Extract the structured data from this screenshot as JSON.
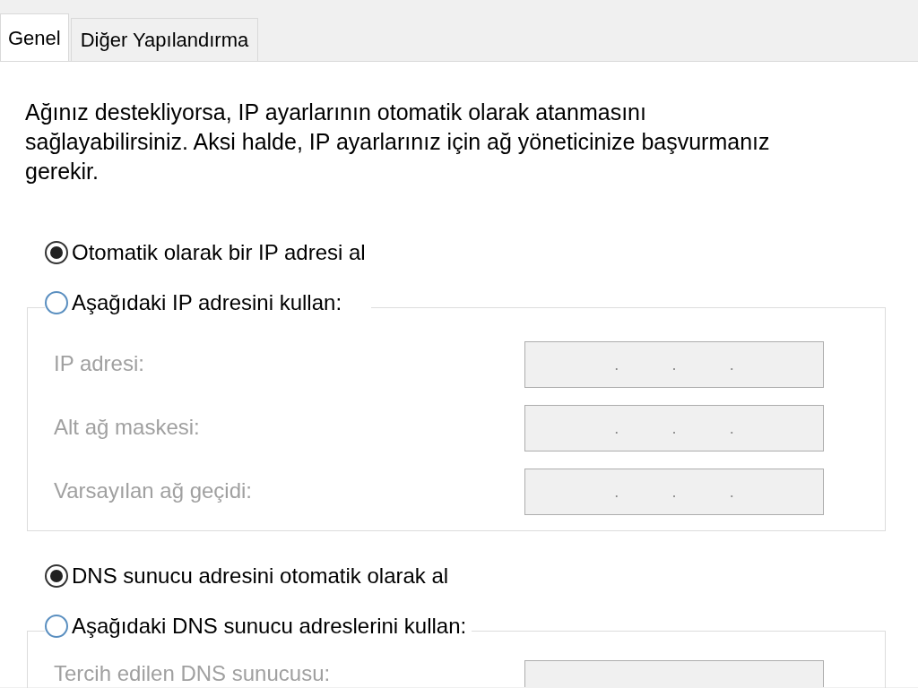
{
  "tabs": [
    {
      "label": "Genel",
      "selected": true
    },
    {
      "label": "Diğer Yapılandırma",
      "selected": false
    }
  ],
  "description": "Ağınız destekliyorsa, IP ayarlarının otomatik olarak atanmasını sağlayabilirsiniz. Aksi halde, IP ayarlarınız için ağ yöneticinize başvurmanız gerekir.",
  "ip_options": [
    {
      "label": "Otomatik olarak bir IP adresi al",
      "selected": true
    },
    {
      "label": "Aşağıdaki IP adresini kullan:",
      "selected": false
    }
  ],
  "ip_fields": [
    {
      "label": "IP adresi:",
      "disabled": true,
      "separators": [
        ".",
        ".",
        "."
      ]
    },
    {
      "label": "Alt ağ maskesi:",
      "disabled": true,
      "separators": [
        ".",
        ".",
        "."
      ]
    },
    {
      "label": "Varsayılan ağ geçidi:",
      "disabled": true,
      "separators": [
        ".",
        ".",
        "."
      ]
    }
  ],
  "dns_options": [
    {
      "label": "DNS sunucu adresini otomatik olarak al",
      "selected": true
    },
    {
      "label": "Aşağıdaki DNS sunucu adreslerini kullan:",
      "selected": false
    }
  ],
  "dns_fields": [
    {
      "label": "Tercih edilen DNS sunucusu:",
      "disabled": true
    }
  ]
}
